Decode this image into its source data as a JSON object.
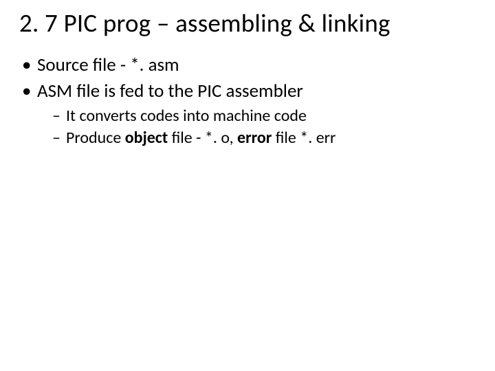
{
  "title": "2. 7 PIC prog – assembling & linking",
  "bullets": {
    "b1": "Source file -    *. asm",
    "b2": "ASM file is fed to the PIC assembler",
    "b2_sub": {
      "s1": "It converts codes into machine code",
      "s2_pre": "Produce ",
      "s2_bold1": "object",
      "s2_mid": " file - *. o, ",
      "s2_bold2": "error",
      "s2_post": " file *. err"
    }
  }
}
